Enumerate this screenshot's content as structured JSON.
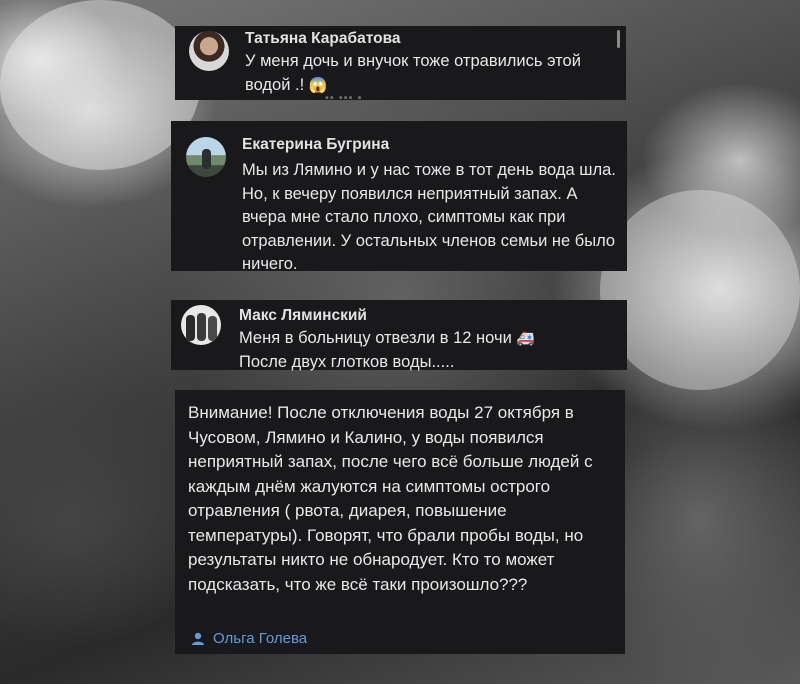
{
  "comments": [
    {
      "author": "Татьяна Карабатова",
      "text_line1": "У меня дочь и внучок тоже отравились этой",
      "text_line2": "водой .!",
      "emoji": "😱",
      "avatar_icon": "user-avatar-photo"
    },
    {
      "author": "Екатерина Бугрина",
      "text": "Мы из Лямино и у нас тоже в тот день вода шла. Но, к вечеру появился неприятный запах. А вчера мне стало плохо, симптомы как при отравлении. У остальных членов семьи не было ничего.",
      "avatar_icon": "user-avatar-photo"
    },
    {
      "author": "Макс Ляминский",
      "text_line1": "Меня в больницу отвезли в 12 ночи",
      "emoji": "🚑",
      "text_line2": "После двух глотков воды.....",
      "avatar_icon": "user-avatar-photo"
    }
  ],
  "post": {
    "text": "Внимание! После отключения воды 27 октября в Чусовом, Лямино и Калино, у воды появился неприятный запах, после чего всё больше людей с каждым днём жалуются на симптомы острого отравления ( рвота, диарея, повышение температуры). Говорят, что брали пробы воды, но результаты никто не обнародует. Кто то может подсказать, что же всё таки произошло???",
    "author": "Ольга Голева",
    "author_icon": "user-icon"
  },
  "colors": {
    "card_bg": "#19191b",
    "link": "#5f9de0",
    "text": "#e8e8e8"
  }
}
